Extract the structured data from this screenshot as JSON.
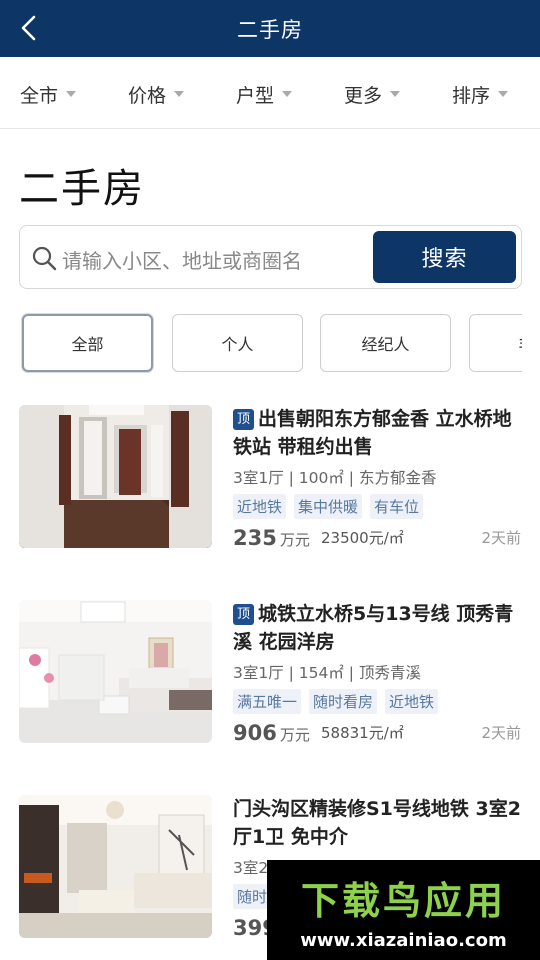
{
  "header": {
    "title": "二手房"
  },
  "filters": [
    {
      "label": "全市"
    },
    {
      "label": "价格"
    },
    {
      "label": "户型"
    },
    {
      "label": "更多"
    },
    {
      "label": "排序"
    }
  ],
  "page_title": "二手房",
  "search": {
    "placeholder": "请输入小区、地址或商圈名",
    "button_label": "搜索"
  },
  "chips": [
    {
      "label": "全部",
      "active": true
    },
    {
      "label": "个人"
    },
    {
      "label": "经纪人"
    },
    {
      "label": "非中"
    }
  ],
  "listings": [
    {
      "badge": "顶",
      "title": "出售朝阳东方郁金香 立水桥地铁站 带租约出售",
      "meta": "3室1厅 | 100㎡ | 东方郁金香",
      "tags": [
        "近地铁",
        "集中供暖",
        "有车位"
      ],
      "price": "235",
      "price_unit": "万元",
      "unit_price": "23500元/㎡",
      "time": "2天前"
    },
    {
      "badge": "顶",
      "title": "城铁立水桥5与13号线 顶秀青溪 花园洋房",
      "meta": "3室1厅 | 154㎡ | 顶秀青溪",
      "tags": [
        "满五唯一",
        "随时看房",
        "近地铁"
      ],
      "price": "906",
      "price_unit": "万元",
      "unit_price": "58831元/㎡",
      "time": "2天前"
    },
    {
      "title": "门头沟区精装修S1号线地铁 3室2厅1卫 免中介",
      "meta": "3室2",
      "tags": [
        "随时"
      ],
      "price": "399"
    }
  ],
  "watermark": {
    "text": "下载鸟应用",
    "url": "www.xiazainiao.com"
  }
}
